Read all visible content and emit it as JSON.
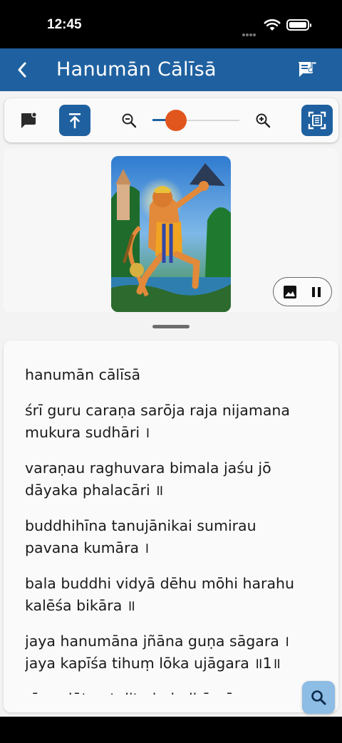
{
  "status_bar": {
    "time": "12:45"
  },
  "app_bar": {
    "title": "Hanumān Cālīsā",
    "back_icon": "chevron-left-icon",
    "lyrics_icon": "music-note-chat-icon"
  },
  "toolbar": {
    "comment_icon": "comment-icon",
    "scroll_top_icon": "scroll-to-top-icon",
    "zoom_out_icon": "zoom-out-icon",
    "zoom_in_icon": "zoom-in-icon",
    "reader_mode_icon": "reader-mode-icon",
    "zoom_level": 0.27
  },
  "media": {
    "image_icon": "image-icon",
    "pause_icon": "pause-icon"
  },
  "verses": [
    "hanumān cālīsā",
    "śrī guru caraṇa sarōja raja nijamana\nmukura sudhāri ।",
    "varaṇau raghuvara bimala jaśu jō\ndāyaka phalacāri ॥",
    "buddhihīna tanujānikai sumirau\npavana kumāra ।",
    "bala buddhi vidyā dēhu mōhi harahu\nkalēśa bikāra ॥",
    "jaya hanumāna jñāna guṇa sāgara ।\njaya kapīśa tihuṃ lōka ujāgara ॥1॥",
    "rāmadūta atulita baladhāmā ।"
  ],
  "colors": {
    "primary": "#1f61a0",
    "accent": "#e0561c",
    "fab": "#8dbce4"
  }
}
